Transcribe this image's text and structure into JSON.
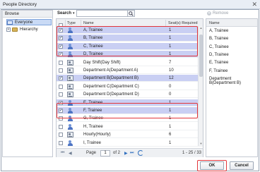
{
  "window": {
    "title": "People Directory",
    "close_glyph": "✕"
  },
  "browse": {
    "header": "Browse",
    "tree": [
      {
        "label": "Everyone",
        "icon": "everyone-icon",
        "selected": true,
        "expander": ""
      },
      {
        "label": "Hierarchy",
        "icon": "hierarchy-folder-icon",
        "selected": false,
        "expander": "+"
      }
    ]
  },
  "search": {
    "label": "Search",
    "caret": "▾",
    "value": "",
    "icon": "search-icon"
  },
  "remove": {
    "label": "Remove",
    "icon": "remove-icon",
    "glyph": "✕"
  },
  "grid": {
    "columns": {
      "type": "Type",
      "name": "Name",
      "seats": "Seat(s) Required"
    },
    "rows": [
      {
        "checked": true,
        "type": "person",
        "name": "A, Trainee",
        "seats": "1",
        "selected": true
      },
      {
        "checked": true,
        "type": "person",
        "name": "B, Trainee",
        "seats": "1",
        "selected": true
      },
      {
        "checked": true,
        "type": "person",
        "name": "C, Trainee",
        "seats": "1",
        "selected": true
      },
      {
        "checked": true,
        "type": "person",
        "name": "D, Trainee",
        "seats": "1",
        "selected": true
      },
      {
        "checked": false,
        "type": "position",
        "name": "Day Shift(Day Shift)",
        "seats": "7",
        "selected": false
      },
      {
        "checked": false,
        "type": "position",
        "name": "Department A(Department A)",
        "seats": "10",
        "selected": false
      },
      {
        "checked": true,
        "type": "position",
        "name": "Department B(Department B)",
        "seats": "12",
        "selected": true
      },
      {
        "checked": false,
        "type": "position",
        "name": "Department C(Department C)",
        "seats": "0",
        "selected": false
      },
      {
        "checked": false,
        "type": "position",
        "name": "Department D(Department D)",
        "seats": "0",
        "selected": false
      },
      {
        "checked": true,
        "type": "person",
        "name": "E, Trainee",
        "seats": "1",
        "selected": true
      },
      {
        "checked": true,
        "type": "person",
        "name": "F, Trainee",
        "seats": "1",
        "selected": true
      },
      {
        "checked": false,
        "type": "person",
        "name": "G, Trainee",
        "seats": "1",
        "selected": false
      },
      {
        "checked": false,
        "type": "person",
        "name": "H, Trainee",
        "seats": "1",
        "selected": false
      },
      {
        "checked": false,
        "type": "position",
        "name": "Hourly(Hourly)",
        "seats": "6",
        "selected": false
      },
      {
        "checked": false,
        "type": "person",
        "name": "I, Trainee",
        "seats": "1",
        "selected": false
      }
    ],
    "check_glyph": "✓"
  },
  "pager": {
    "first": "⏮",
    "prev": "◀",
    "page_label": "Page",
    "page_value": "1",
    "of_label": "of 2",
    "next": "▶",
    "last": "⏭",
    "summary": "1 - 25 / 33"
  },
  "selected_list": {
    "header": "Name",
    "items": [
      "A, Trainee",
      "B, Trainee",
      "C, Trainee",
      "D, Trainee",
      "E, Trainee",
      "F, Trainee",
      "Department B(Department B)"
    ]
  },
  "buttons": {
    "ok": "OK",
    "cancel": "Cancel"
  },
  "colors": {
    "selection": "#c9cff3",
    "highlight_outline": "#e2353a",
    "tree_selection": "#c9daf5"
  }
}
